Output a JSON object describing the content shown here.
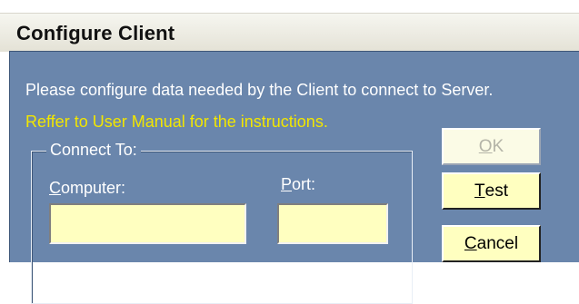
{
  "window": {
    "title": "Configure Client"
  },
  "messages": {
    "info": "Please configure data needed by the Client to connect to Server.",
    "hint": "Reffer to User Manual for the instructions."
  },
  "connect_group": {
    "legend": "Connect To:",
    "computer_label_accel": "C",
    "computer_label_rest": "omputer:",
    "computer_value": "",
    "port_label_accel": "P",
    "port_label_rest": "ort:",
    "port_value": ""
  },
  "buttons": {
    "ok_accel": "O",
    "ok_rest": "K",
    "test_accel": "T",
    "test_rest": "est",
    "cancel_accel": "C",
    "cancel_rest": "ancel"
  },
  "colors": {
    "client_background": "#6a86ac",
    "hint_text": "#f2e600",
    "field_background": "#ffffc0"
  }
}
